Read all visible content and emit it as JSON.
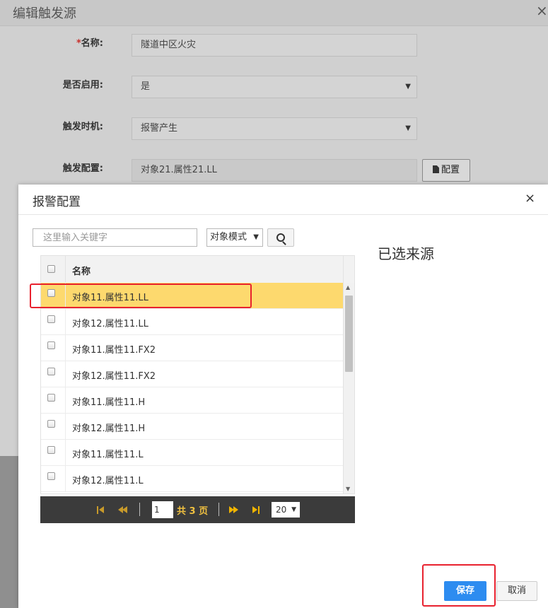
{
  "background_dialog": {
    "title": "编辑触发源",
    "close_glyph": "×",
    "fields": {
      "name": {
        "required_mark": "*",
        "label": "名称:",
        "value": "隧道中区火灾"
      },
      "enabled": {
        "label": "是否启用:",
        "value": "是"
      },
      "trigger_time": {
        "label": "触发时机:",
        "value": "报警产生"
      },
      "trigger_config": {
        "label": "触发配置:",
        "value": "对象21.属性21.LL",
        "button_label": "配置"
      }
    }
  },
  "alarm_dialog": {
    "title": "报警配置",
    "close_glyph": "×",
    "search": {
      "placeholder": "这里输入关键字",
      "value": ""
    },
    "mode_select": {
      "value": "对象模式"
    },
    "selected_panel_title": "已选来源",
    "table": {
      "header": "名称",
      "rows": [
        {
          "name": "对象11.属性11.LL",
          "highlighted": true
        },
        {
          "name": "对象12.属性11.LL"
        },
        {
          "name": "对象11.属性11.FX2"
        },
        {
          "name": "对象12.属性11.FX2"
        },
        {
          "name": "对象11.属性11.H"
        },
        {
          "name": "对象12.属性11.H"
        },
        {
          "name": "对象11.属性11.L"
        },
        {
          "name": "对象12.属性11.L"
        }
      ]
    },
    "pager": {
      "page": "1",
      "total_text": "共 3 页",
      "page_size": "20"
    },
    "buttons": {
      "save": "保存",
      "cancel": "取消"
    }
  },
  "colors": {
    "row_highlight": "#fdd96e",
    "primary_button": "#2d8cf0",
    "annotation": "#e8222f",
    "pager_bg": "#3b3b3b"
  },
  "icons": {
    "config_button": "document-icon",
    "search_button": "search-icon"
  }
}
